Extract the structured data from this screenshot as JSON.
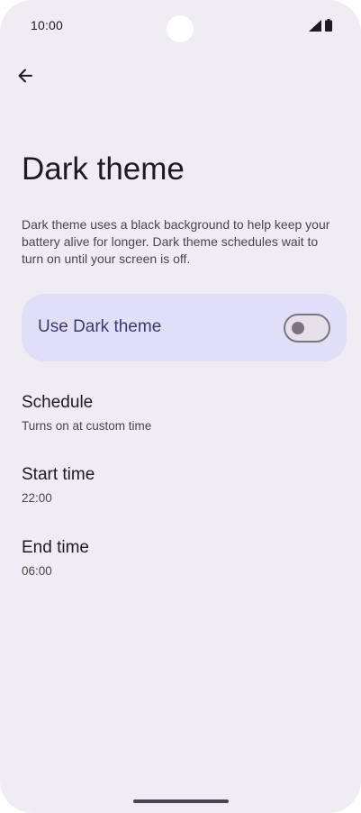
{
  "status_bar": {
    "time": "10:00",
    "icons": [
      "signal-icon",
      "battery-icon"
    ]
  },
  "toolbar": {
    "back_icon": "arrow-left-icon"
  },
  "page": {
    "title": "Dark theme",
    "description": "Dark theme uses a black background to help keep your battery alive for longer. Dark theme schedules wait to turn on until your screen is off."
  },
  "main_toggle": {
    "label": "Use Dark theme",
    "state": "off"
  },
  "settings": [
    {
      "title": "Schedule",
      "summary": "Turns on at custom time"
    },
    {
      "title": "Start time",
      "summary": "22:00"
    },
    {
      "title": "End time",
      "summary": "06:00"
    }
  ],
  "colors": {
    "background": "#f0ecf4",
    "toggle_card": "#e1dff8",
    "toggle_label": "#3d3a6b",
    "primary_text": "#1d1b20",
    "secondary_text": "#49454f",
    "switch_outline": "#79747e"
  }
}
